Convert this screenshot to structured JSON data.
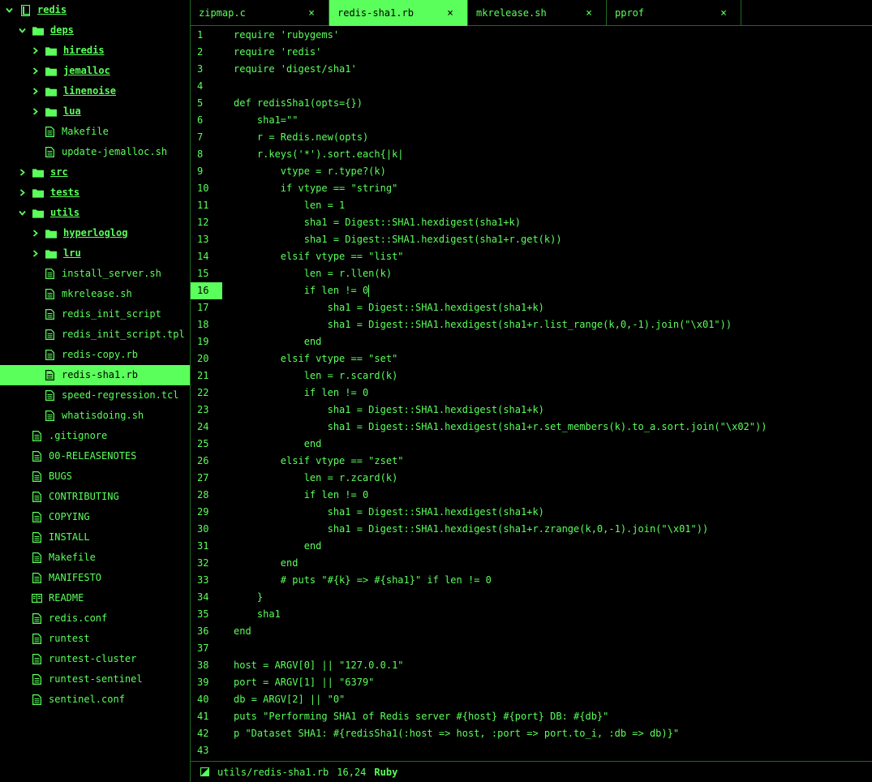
{
  "theme": {
    "accent": "#5bff5b",
    "background": "#000000",
    "separator": "#1f6a1f"
  },
  "sidebar": {
    "items": [
      {
        "label": "redis",
        "kind": "folder-root",
        "depth": 0,
        "expanded": true,
        "icon": "repo-icon"
      },
      {
        "label": "deps",
        "kind": "folder",
        "depth": 1,
        "expanded": true,
        "icon": "folder-icon"
      },
      {
        "label": "hiredis",
        "kind": "folder",
        "depth": 2,
        "expanded": false,
        "icon": "folder-icon"
      },
      {
        "label": "jemalloc",
        "kind": "folder",
        "depth": 2,
        "expanded": false,
        "icon": "folder-icon"
      },
      {
        "label": "linenoise",
        "kind": "folder",
        "depth": 2,
        "expanded": false,
        "icon": "folder-icon"
      },
      {
        "label": "lua",
        "kind": "folder",
        "depth": 2,
        "expanded": false,
        "icon": "folder-icon"
      },
      {
        "label": "Makefile",
        "kind": "file",
        "depth": 2,
        "icon": "file-icon"
      },
      {
        "label": "update-jemalloc.sh",
        "kind": "file",
        "depth": 2,
        "icon": "file-icon"
      },
      {
        "label": "src",
        "kind": "folder",
        "depth": 1,
        "expanded": false,
        "icon": "folder-icon"
      },
      {
        "label": "tests",
        "kind": "folder",
        "depth": 1,
        "expanded": false,
        "icon": "folder-icon"
      },
      {
        "label": "utils",
        "kind": "folder",
        "depth": 1,
        "expanded": true,
        "icon": "folder-icon"
      },
      {
        "label": "hyperloglog",
        "kind": "folder",
        "depth": 2,
        "expanded": false,
        "icon": "folder-icon"
      },
      {
        "label": "lru",
        "kind": "folder",
        "depth": 2,
        "expanded": false,
        "icon": "folder-icon"
      },
      {
        "label": "install_server.sh",
        "kind": "file",
        "depth": 2,
        "icon": "file-icon"
      },
      {
        "label": "mkrelease.sh",
        "kind": "file",
        "depth": 2,
        "icon": "file-icon"
      },
      {
        "label": "redis_init_script",
        "kind": "file",
        "depth": 2,
        "icon": "file-icon"
      },
      {
        "label": "redis_init_script.tpl",
        "kind": "file",
        "depth": 2,
        "icon": "file-icon"
      },
      {
        "label": "redis-copy.rb",
        "kind": "file",
        "depth": 2,
        "icon": "file-icon"
      },
      {
        "label": "redis-sha1.rb",
        "kind": "file",
        "depth": 2,
        "icon": "file-icon",
        "selected": true
      },
      {
        "label": "speed-regression.tcl",
        "kind": "file",
        "depth": 2,
        "icon": "file-icon"
      },
      {
        "label": "whatisdoing.sh",
        "kind": "file",
        "depth": 2,
        "icon": "file-icon"
      },
      {
        "label": ".gitignore",
        "kind": "file",
        "depth": 1,
        "icon": "file-icon"
      },
      {
        "label": "00-RELEASENOTES",
        "kind": "file",
        "depth": 1,
        "icon": "file-icon"
      },
      {
        "label": "BUGS",
        "kind": "file",
        "depth": 1,
        "icon": "file-icon"
      },
      {
        "label": "CONTRIBUTING",
        "kind": "file",
        "depth": 1,
        "icon": "file-icon"
      },
      {
        "label": "COPYING",
        "kind": "file",
        "depth": 1,
        "icon": "file-icon"
      },
      {
        "label": "INSTALL",
        "kind": "file",
        "depth": 1,
        "icon": "file-icon"
      },
      {
        "label": "Makefile",
        "kind": "file",
        "depth": 1,
        "icon": "file-icon"
      },
      {
        "label": "MANIFESTO",
        "kind": "file",
        "depth": 1,
        "icon": "file-icon"
      },
      {
        "label": "README",
        "kind": "file",
        "depth": 1,
        "icon": "readme-icon"
      },
      {
        "label": "redis.conf",
        "kind": "file",
        "depth": 1,
        "icon": "file-icon"
      },
      {
        "label": "runtest",
        "kind": "file",
        "depth": 1,
        "icon": "file-icon"
      },
      {
        "label": "runtest-cluster",
        "kind": "file",
        "depth": 1,
        "icon": "file-icon"
      },
      {
        "label": "runtest-sentinel",
        "kind": "file",
        "depth": 1,
        "icon": "file-icon"
      },
      {
        "label": "sentinel.conf",
        "kind": "file",
        "depth": 1,
        "icon": "file-icon"
      }
    ]
  },
  "tabs": [
    {
      "title": "zipmap.c",
      "active": false,
      "close": "×"
    },
    {
      "title": "redis-sha1.rb",
      "active": true,
      "close": "×"
    },
    {
      "title": "mkrelease.sh",
      "active": false,
      "close": "×"
    },
    {
      "title": "pprof",
      "active": false,
      "close": "×"
    }
  ],
  "editor": {
    "current_line": 16,
    "cursor_column": 24,
    "lines": [
      "require 'rubygems'",
      "require 'redis'",
      "require 'digest/sha1'",
      "",
      "def redisSha1(opts={})",
      "    sha1=\"\"",
      "    r = Redis.new(opts)",
      "    r.keys('*').sort.each{|k|",
      "        vtype = r.type?(k)",
      "        if vtype == \"string\"",
      "            len = 1",
      "            sha1 = Digest::SHA1.hexdigest(sha1+k)",
      "            sha1 = Digest::SHA1.hexdigest(sha1+r.get(k))",
      "        elsif vtype == \"list\"",
      "            len = r.llen(k)",
      "            if len != 0",
      "                sha1 = Digest::SHA1.hexdigest(sha1+k)",
      "                sha1 = Digest::SHA1.hexdigest(sha1+r.list_range(k,0,-1).join(\"\\x01\"))",
      "            end",
      "        elsif vtype == \"set\"",
      "            len = r.scard(k)",
      "            if len != 0",
      "                sha1 = Digest::SHA1.hexdigest(sha1+k)",
      "                sha1 = Digest::SHA1.hexdigest(sha1+r.set_members(k).to_a.sort.join(\"\\x02\"))",
      "            end",
      "        elsif vtype == \"zset\"",
      "            len = r.zcard(k)",
      "            if len != 0",
      "                sha1 = Digest::SHA1.hexdigest(sha1+k)",
      "                sha1 = Digest::SHA1.hexdigest(sha1+r.zrange(k,0,-1).join(\"\\x01\"))",
      "            end",
      "        end",
      "        # puts \"#{k} => #{sha1}\" if len != 0",
      "    }",
      "    sha1",
      "end",
      "",
      "host = ARGV[0] || \"127.0.0.1\"",
      "port = ARGV[1] || \"6379\"",
      "db = ARGV[2] || \"0\"",
      "puts \"Performing SHA1 of Redis server #{host} #{port} DB: #{db}\"",
      "p \"Dataset SHA1: #{redisSha1(:host => host, :port => port.to_i, :db => db)}\"",
      ""
    ]
  },
  "status": {
    "icon": "split-pane-icon",
    "path": "utils/redis-sha1.rb",
    "position": "16,24",
    "language": "Ruby"
  }
}
